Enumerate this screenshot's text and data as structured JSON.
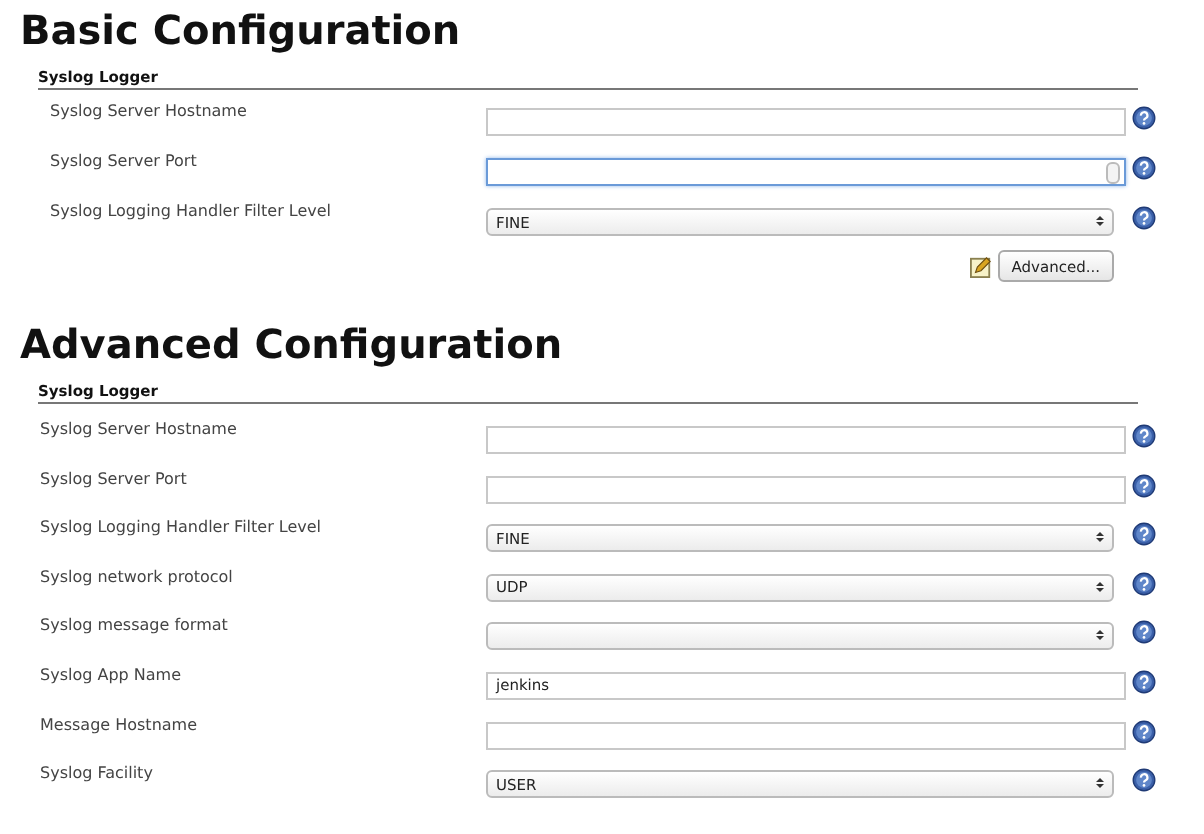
{
  "sections": [
    {
      "heading": "Basic Configuration",
      "group": "Syslog Logger",
      "fields": [
        {
          "label": "Syslog Server Hostname",
          "kind": "text",
          "focused": false
        },
        {
          "label": "Syslog Server Port",
          "kind": "number",
          "focused": true
        },
        {
          "label": "Syslog Logging Handler Filter Level",
          "kind": "select",
          "value": "FINE",
          "focused": false
        }
      ],
      "button": "Advanced..."
    },
    {
      "heading": "Advanced Configuration",
      "group": "Syslog Logger",
      "fields": [
        {
          "label": "Syslog Server Hostname",
          "kind": "text",
          "focused": false
        },
        {
          "label": "Syslog Server Port",
          "kind": "text",
          "focused": false
        },
        {
          "label": "Syslog Logging Handler Filter Level",
          "kind": "select",
          "value": "FINE",
          "focused": false
        },
        {
          "label": "Syslog network protocol",
          "kind": "select",
          "value": "UDP",
          "focused": false
        },
        {
          "label": "Syslog message format",
          "kind": "select",
          "focused": false
        },
        {
          "label": "Syslog App Name",
          "kind": "text",
          "value": "jenkins",
          "focused": false
        },
        {
          "label": "Message Hostname",
          "kind": "text",
          "focused": false
        },
        {
          "label": "Syslog Facility",
          "kind": "select",
          "value": "USER",
          "focused": false
        }
      ]
    }
  ]
}
